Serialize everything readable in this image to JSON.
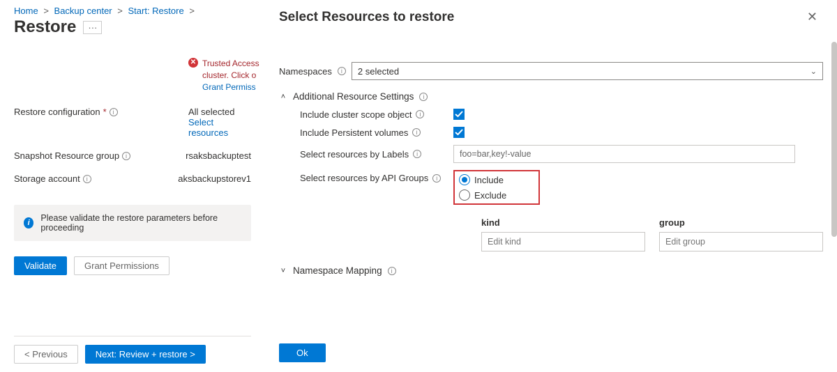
{
  "breadcrumb": {
    "home": "Home",
    "backup_center": "Backup center",
    "start_restore": "Start: Restore"
  },
  "page_title": "Restore",
  "more_btn": "···",
  "error": {
    "line1": "Trusted Access",
    "line2": "cluster. Click o",
    "link": "Grant Permiss"
  },
  "form": {
    "restore_conf_label": "Restore configuration",
    "restore_conf_val": "All selected",
    "restore_conf_link": "Select resources",
    "snapshot_label": "Snapshot Resource group",
    "snapshot_val": "rsaksbackuptest",
    "storage_label": "Storage account",
    "storage_val": "aksbackupstorev1"
  },
  "banner": "Please validate the restore parameters before proceeding",
  "buttons": {
    "validate": "Validate",
    "grant": "Grant Permissions",
    "prev": "< Previous",
    "next": "Next: Review + restore >"
  },
  "panel": {
    "title": "Select Resources to restore",
    "namespaces_label": "Namespaces",
    "namespaces_value": "2 selected",
    "section_additional": "Additional Resource Settings",
    "include_cluster": "Include cluster scope object",
    "include_pv": "Include Persistent volumes",
    "labels_label": "Select resources by Labels",
    "labels_value": "foo=bar,key!-value",
    "api_label": "Select resources by API Groups",
    "radio_include": "Include",
    "radio_exclude": "Exclude",
    "col_kind": "kind",
    "col_group": "group",
    "kind_ph": "Edit kind",
    "group_ph": "Edit group",
    "section_nsmap": "Namespace Mapping",
    "ok": "Ok"
  }
}
